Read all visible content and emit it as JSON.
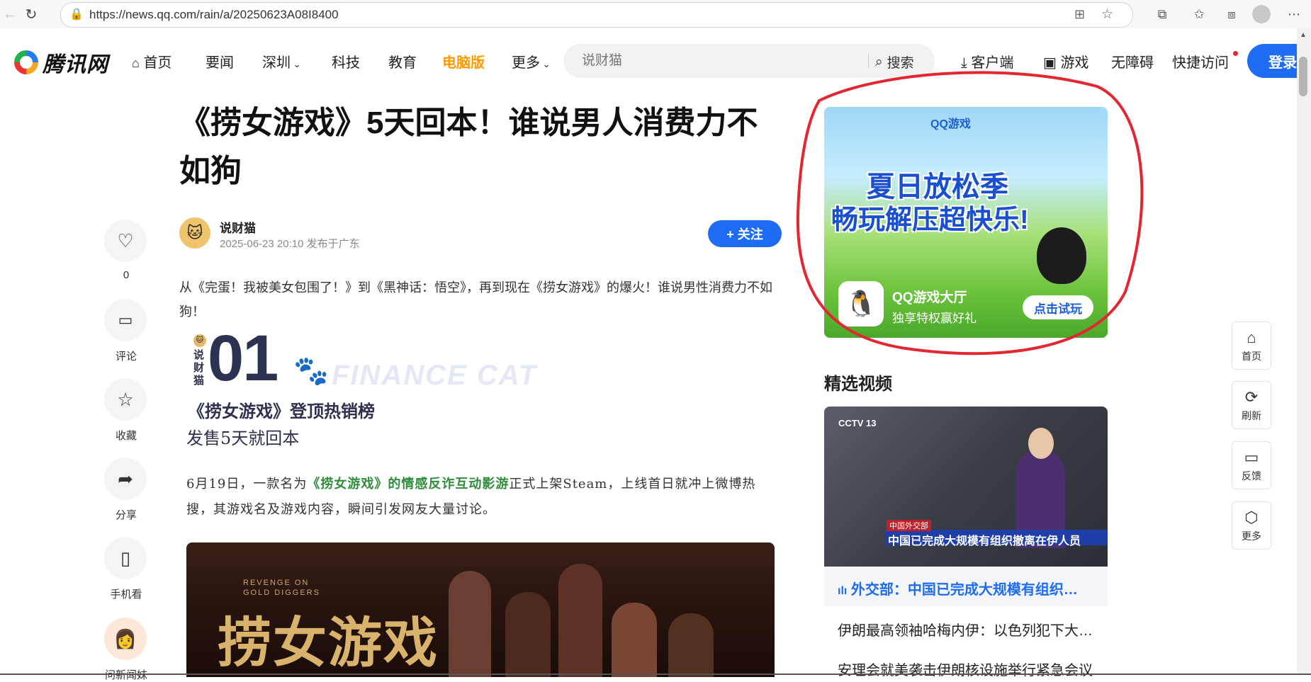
{
  "browser": {
    "url": "https://news.qq.com/rain/a/20250623A08I8400"
  },
  "site": {
    "logo_text": "腾讯网",
    "nav": [
      "首页",
      "要闻",
      "深圳",
      "科技",
      "教育",
      "电脑版",
      "更多"
    ],
    "search_placeholder": "说财猫",
    "search_button": "搜索",
    "right_links": [
      "客户端",
      "游戏",
      "无障碍",
      "快捷访问"
    ],
    "login": "登录"
  },
  "actions": [
    {
      "icon": "heart-icon",
      "label": "0"
    },
    {
      "icon": "comment-icon",
      "label": "评论"
    },
    {
      "icon": "star-icon",
      "label": "收藏"
    },
    {
      "icon": "share-icon",
      "label": "分享"
    },
    {
      "icon": "phone-icon",
      "label": "手机看"
    },
    {
      "icon": "avatar-icon",
      "label": "问新闻妹"
    }
  ],
  "article": {
    "title": "《捞女游戏》5天回本！谁说男人消费力不如狗",
    "author": "说财猫",
    "meta": "2025-06-23 20:10 发布于广东",
    "follow": "+ 关注",
    "para1": "从《完蛋！我被美女包围了！》到《黑神话：悟空》，再到现在《捞女游戏》的爆火！谁说男性消费力不如狗！",
    "badge_vertical": "说财猫",
    "big_number": "01",
    "watermark": "FINANCE CAT",
    "subtitle1": "《捞女游戏》登顶热销榜",
    "subtitle2": "发售5天就回本",
    "para2_before": "6月19日，一款名为",
    "para2_link": "《捞女游戏》的情感反诈互动影游",
    "para2_after": "正式上架Steam，上线首日就冲上微博热搜，其游戏名及游戏内容，瞬间引发网友大量讨论。",
    "image_title": "捞女游戏",
    "image_en": "REVENGE ON GOLD DIGGERS"
  },
  "ad": {
    "brand": "QQ游戏",
    "headline1": "夏日放松季",
    "headline2": "畅玩解压超快乐!",
    "app_name": "QQ游戏大厅",
    "app_sub": "独享特权赢好礼",
    "cta": "点击试玩"
  },
  "videos": {
    "heading": "精选视频",
    "channel": "CCTV 13",
    "ticker_tag": "中国外交部",
    "ticker_headline": "中国已完成大规模有组织撤离在伊人员",
    "caption": "外交部：中国已完成大规模有组织…",
    "items": [
      "伊朗最高领袖哈梅内伊：以色列犯下大…",
      "安理会就美袭击伊朗核设施举行紧急会议"
    ]
  },
  "tools": [
    {
      "icon": "home-icon",
      "label": "首页"
    },
    {
      "icon": "refresh-icon",
      "label": "刷新"
    },
    {
      "icon": "feedback-icon",
      "label": "反馈"
    },
    {
      "icon": "more-icon",
      "label": "更多"
    }
  ]
}
